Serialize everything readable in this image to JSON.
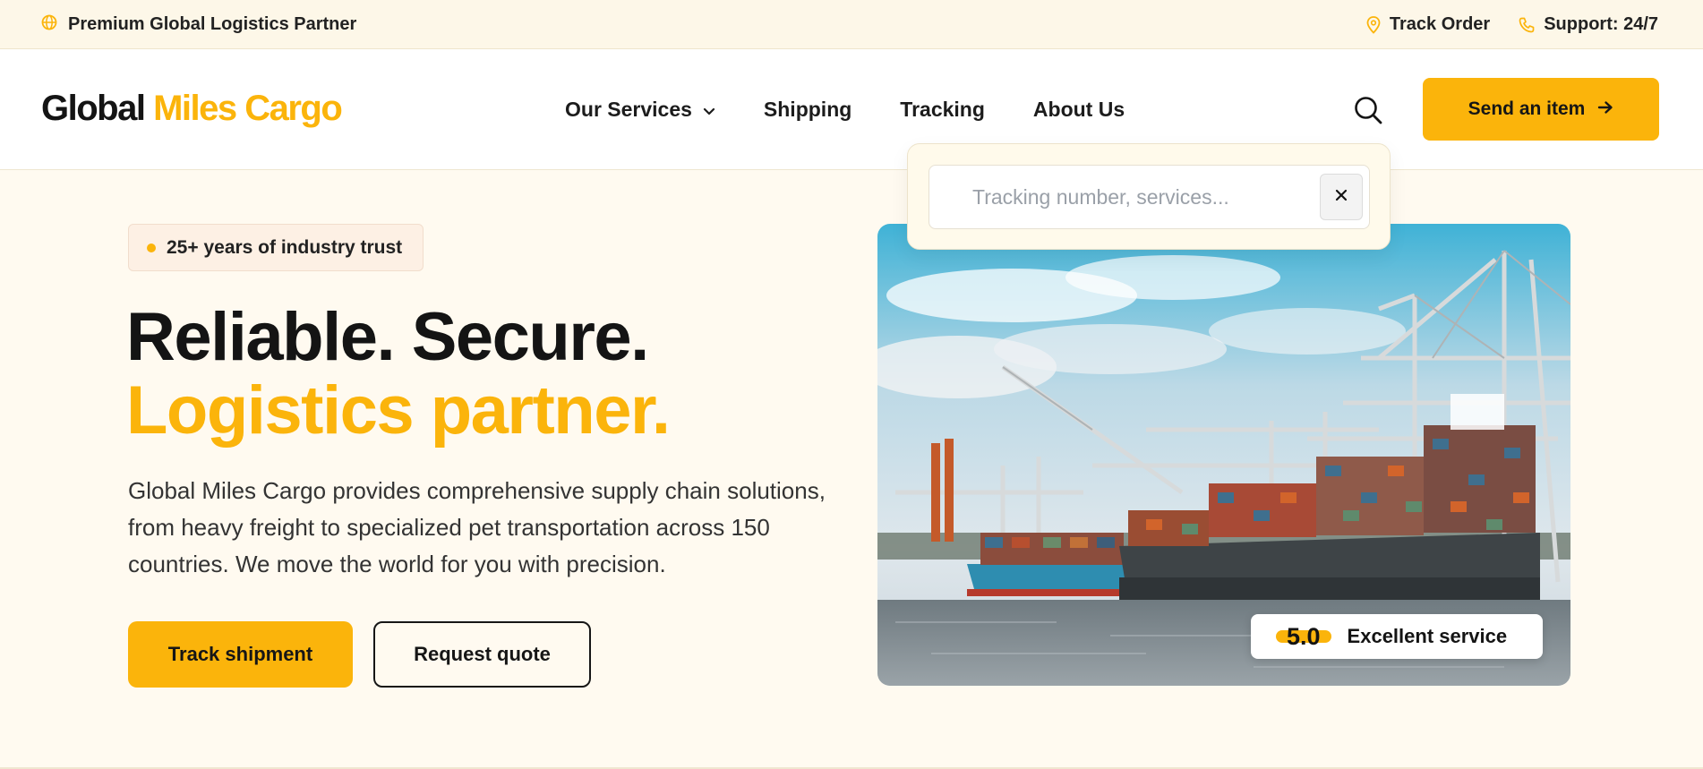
{
  "topbar": {
    "tagline": "Premium Global Logistics Partner",
    "track_order": "Track Order",
    "support": "Support: 24/7"
  },
  "header": {
    "logo_part1": "Global",
    "logo_part2": "Miles Cargo",
    "nav": {
      "services": "Our Services",
      "shipping": "Shipping",
      "tracking": "Tracking",
      "about": "About Us"
    },
    "cta": "Send an item"
  },
  "search": {
    "placeholder": "Tracking number, services..."
  },
  "hero": {
    "badge": "25+ years of industry trust",
    "title_line1": "Reliable. Secure.",
    "title_line2": "Logistics partner.",
    "description": "Global Miles Cargo provides comprehensive supply chain solutions, from heavy freight to specialized pet transportation across 150 countries. We move the world for you with precision.",
    "primary_button": "Track shipment",
    "secondary_button": "Request quote",
    "rating_score": "5.0",
    "rating_label": "Excellent service"
  },
  "colors": {
    "accent": "#fbb40b",
    "background": "#fffaf0",
    "text": "#141414"
  },
  "icons": {
    "globe": "globe-icon",
    "location": "location-pin-icon",
    "phone": "phone-icon",
    "chevron": "chevron-down-icon",
    "search": "search-icon",
    "arrow": "arrow-right-icon",
    "close": "close-icon"
  }
}
